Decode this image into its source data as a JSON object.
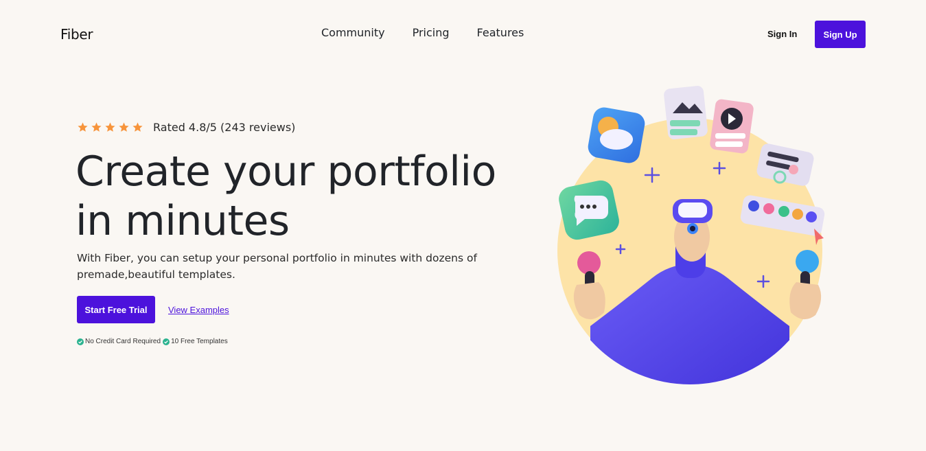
{
  "header": {
    "logo": "Fiber",
    "nav": [
      "Community",
      "Pricing",
      "Features"
    ],
    "sign_in": "Sign In",
    "sign_up": "Sign Up"
  },
  "hero": {
    "stars": 5,
    "rating_text": "Rated 4.8/5 (243 reviews)",
    "title_line1": "Create your portfolio",
    "title_line2": "in minutes",
    "subtitle": "With Fiber, you can setup your personal portfolio in minutes with dozens of premade,beautiful templates.",
    "primary_cta": "Start Free Trial",
    "secondary_cta": "View Examples",
    "checks": [
      "No Credit Card Required",
      "10 Free Templates"
    ]
  },
  "colors": {
    "accent": "#4c12dc",
    "star": "#f7943b",
    "check": "#2bb38f",
    "background": "#faf7f3",
    "circle": "#fde3a7"
  },
  "icons": [
    "star-icon",
    "check-circle-icon",
    "vr-character-illustration"
  ]
}
